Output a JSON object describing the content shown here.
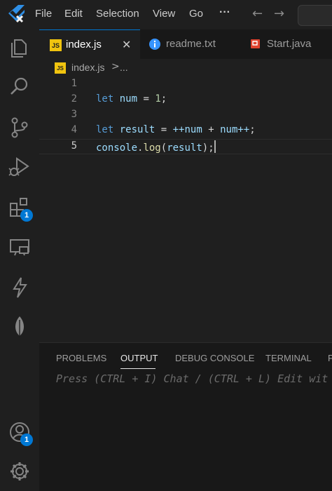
{
  "menu": [
    "File",
    "Edit",
    "Selection",
    "View",
    "Go"
  ],
  "menu_more": "···",
  "nav": {
    "back": "←",
    "forward": "→"
  },
  "activity": {
    "extensions_badge": "1",
    "accounts_badge": "1"
  },
  "tabs": [
    {
      "label": "index.js",
      "icon": "js-icon",
      "close": "✕"
    },
    {
      "label": "readme.txt",
      "icon": "info-icon"
    },
    {
      "label": "Start.java",
      "icon": "java-icon"
    }
  ],
  "breadcrumb": {
    "file": "index.js",
    "sep": ">",
    "rest": "..."
  },
  "editor": {
    "line_numbers": [
      "1",
      "2",
      "3",
      "4",
      "5"
    ],
    "code": {
      "l2": {
        "kw": "let",
        "var": "num",
        "op": "=",
        "num": "1",
        "end": ";"
      },
      "l4": {
        "kw": "let",
        "var": "result",
        "op": "=",
        "expr1": "++num",
        "plus": "+",
        "expr2": "num++",
        "end": ";"
      },
      "l5": {
        "obj": "console",
        "dot": ".",
        "fn": "log",
        "open": "(",
        "arg": "result",
        "close": ")",
        "end": ";"
      }
    }
  },
  "panel": {
    "tabs": [
      "PROBLEMS",
      "OUTPUT",
      "DEBUG CONSOLE",
      "TERMINAL",
      "P"
    ],
    "active_tab": "OUTPUT",
    "hint": "Press (CTRL + I) Chat / (CTRL + L) Edit wit"
  },
  "colors": {
    "accent": "#0078d4",
    "js_yellow": "#f1c40f",
    "java_red": "#e0432f",
    "info_blue": "#3794ff"
  }
}
